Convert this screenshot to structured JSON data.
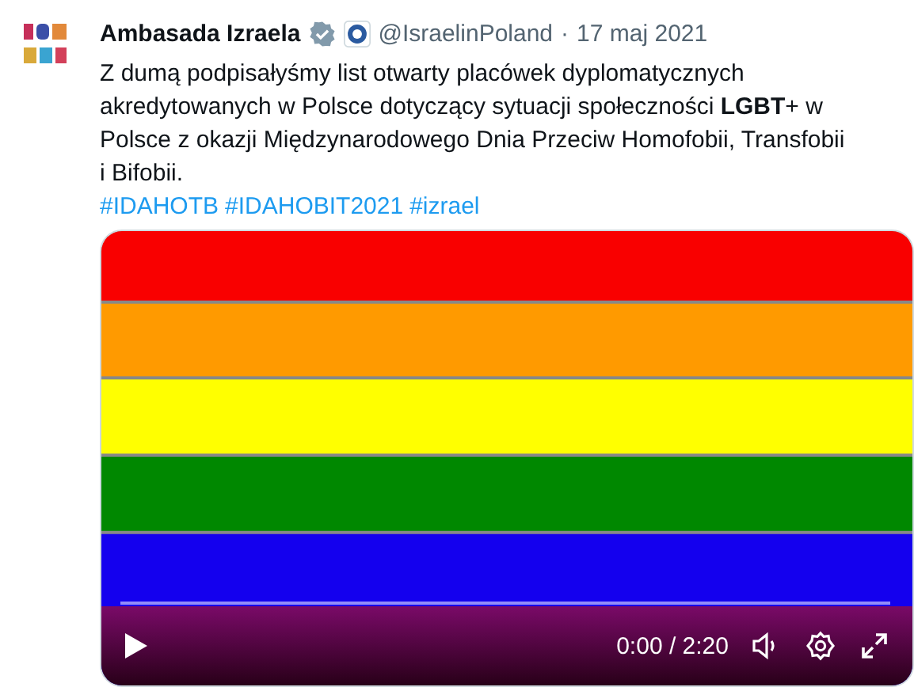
{
  "tweet": {
    "author": "Ambasada Izraela",
    "verified": true,
    "handle": "@IsraelinPoland",
    "separator": "·",
    "date": "17 maj 2021",
    "body": "Z dumą podpisałyśmy list otwarty placówek dyplomatycznych akredytowanych w Polsce dotyczący sytuacji społeczności **LGBT**+ w Polsce z okazji Międzynarodowego Dnia Przeciw Homofobii, Transfobii i Bifobii.",
    "hashtags": [
      "#IDAHOTB",
      "#IDAHOBIT2021",
      "#izrael"
    ]
  },
  "video": {
    "time": "0:00 / 2:20"
  }
}
